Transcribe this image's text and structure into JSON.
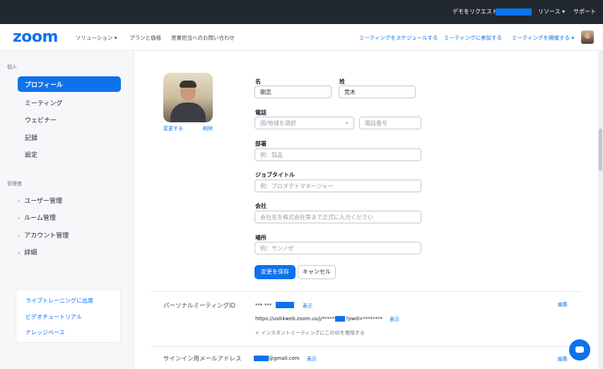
{
  "topbar": {
    "demo_request": "デモをリクエスト",
    "resources": "リソース ▾",
    "support": "サポート"
  },
  "nav": {
    "logo": "zoom",
    "solutions": "ソリューション ▾",
    "plans": "プランと価格",
    "contact_sales": "営業担当へのお問い合わせ",
    "schedule": "ミーティングをスケジュールする",
    "join": "ミーティングに参加する",
    "host": "ミーティングを開催する ▾"
  },
  "sidebar": {
    "personal_label": "個人",
    "items": [
      "プロフィール",
      "ミーティング",
      "ウェビナー",
      "記録",
      "設定"
    ],
    "admin_label": "管理者",
    "admin_items": [
      "ユーザー管理",
      "ルーム管理",
      "アカウント管理",
      "詳細"
    ],
    "help_links": [
      "ライブトレーニングに出席",
      "ビデオチュートリアル",
      "ナレッジベース"
    ]
  },
  "profile": {
    "change_photo": "変更する",
    "delete_photo": "削除",
    "first_name_label": "名",
    "first_name_value": "剛志",
    "last_name_label": "姓",
    "last_name_value": "荒木",
    "phone_label": "電話",
    "country_placeholder": "国/地域を選択",
    "phone_placeholder": "電話番号",
    "department_label": "部署",
    "department_placeholder": "例：製品",
    "job_title_label": "ジョブタイトル",
    "job_title_placeholder": "例：プロダクトマネージャー",
    "company_label": "会社",
    "company_placeholder": "会社名を株式会社等まで正式に入力ください",
    "location_label": "場所",
    "location_placeholder": "例：サンノゼ",
    "save_button": "変更を保存",
    "cancel_button": "キャンセル"
  },
  "pmi": {
    "title": "パーソナルミーティングID",
    "id_masked": "*** ***",
    "show": "表示",
    "url_prefix": "https://us04web.zoom.us/j/*******",
    "url_suffix": "?pwd=********",
    "show2": "表示",
    "instant_note": "× インスタントミーティングにこのIDを使用する",
    "edit": "編集"
  },
  "email": {
    "title": "サインイン用メールアドレス",
    "value_suffix": "@gmail.com",
    "show": "表示",
    "edit": "編集"
  },
  "colors": {
    "accent": "#0e72ed",
    "topbar": "#22282f",
    "sidebar": "#f7f7fa"
  }
}
